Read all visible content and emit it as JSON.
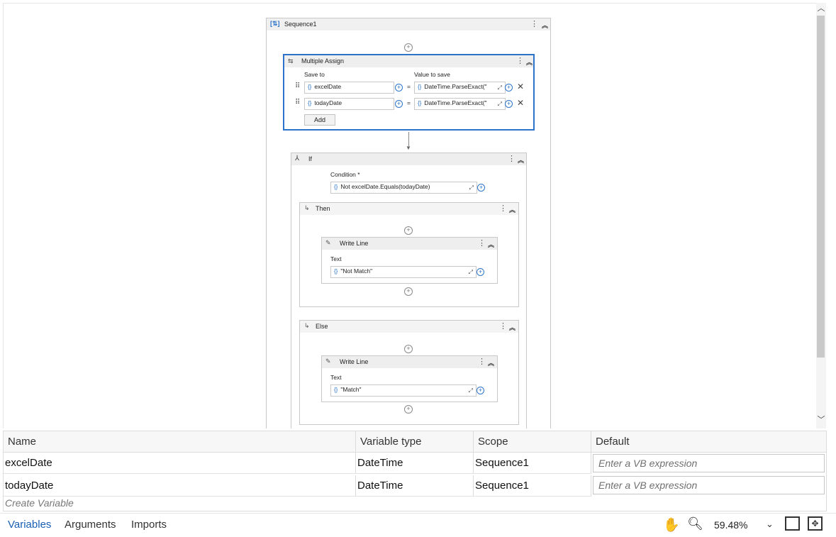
{
  "canvas": {
    "sequence": {
      "title": "Sequence1"
    },
    "multiple_assign": {
      "title": "Multiple Assign",
      "col_save_to": "Save to",
      "col_value": "Value to save",
      "rows": [
        {
          "target": "excelDate",
          "value": "DateTime.ParseExact(\""
        },
        {
          "target": "todayDate",
          "value": "DateTime.ParseExact(\""
        }
      ],
      "add_label": "Add",
      "equals": "="
    },
    "if_activity": {
      "title": "If",
      "condition_label": "Condition *",
      "condition_value": "Not excelDate.Equals(todayDate)",
      "then": {
        "title": "Then",
        "write_line": {
          "title": "Write Line",
          "text_label": "Text",
          "text_value": "\"Not Match\""
        }
      },
      "else": {
        "title": "Else",
        "write_line": {
          "title": "Write Line",
          "text_label": "Text",
          "text_value": "\"Match\""
        }
      }
    }
  },
  "variables": {
    "columns": [
      "Name",
      "Variable type",
      "Scope",
      "Default"
    ],
    "rows": [
      {
        "name": "excelDate",
        "type": "DateTime",
        "scope": "Sequence1",
        "default_placeholder": "Enter a VB expression"
      },
      {
        "name": "todayDate",
        "type": "DateTime",
        "scope": "Sequence1",
        "default_placeholder": "Enter a VB expression"
      }
    ],
    "create_placeholder": "Create Variable"
  },
  "bottom_bar": {
    "tabs": [
      "Variables",
      "Arguments",
      "Imports"
    ],
    "active_tab": "Variables",
    "zoom": "59.48%"
  },
  "colors": {
    "accent": "#1a5fb4",
    "selection_border": "#2c74c9"
  }
}
